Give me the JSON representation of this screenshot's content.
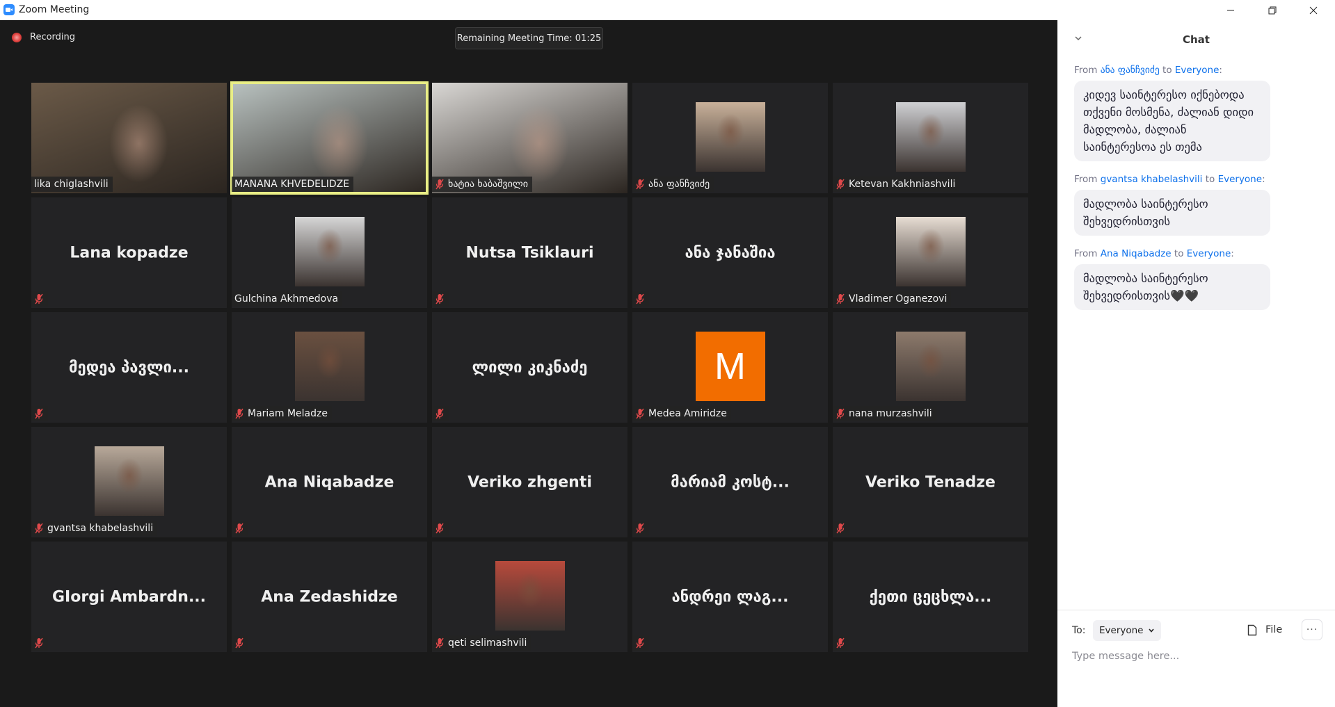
{
  "window": {
    "title": "Zoom Meeting",
    "controls": {
      "minimize": "minimize",
      "maximize": "restore",
      "close": "close"
    }
  },
  "meeting": {
    "recording_label": "Recording",
    "timer_text": "Remaining Meeting Time: 01:25"
  },
  "participants": [
    {
      "name": "lika chiglashvili",
      "mode": "video",
      "muted": false,
      "active": false,
      "scene": "#6b5a48"
    },
    {
      "name": "MANANA KHVEDELIDZE",
      "mode": "video",
      "muted": false,
      "active": true,
      "scene": "#b9c2c0"
    },
    {
      "name": "ხატია ხაბაშვილი",
      "mode": "video",
      "muted": true,
      "active": false,
      "scene": "#d9d7d4"
    },
    {
      "name": "ანა ფანჩვიძე",
      "mode": "photo",
      "muted": true,
      "active": false,
      "scene": "#c9b19a"
    },
    {
      "name": "Ketevan Kakhniashvili",
      "mode": "photo",
      "muted": true,
      "active": false,
      "scene": "#cfd0d3"
    },
    {
      "name": "Lana kopadze",
      "mode": "name",
      "muted": true,
      "active": false
    },
    {
      "name": "Gulchina Akhmedova",
      "mode": "photo",
      "muted": false,
      "active": false,
      "scene": "#d6d6d6"
    },
    {
      "name": "Nutsa Tsiklauri",
      "mode": "name",
      "muted": true,
      "active": false
    },
    {
      "name": "ანა ჯანაშია",
      "mode": "name",
      "muted": true,
      "active": false
    },
    {
      "name": "Vladimer Oganezovi",
      "mode": "photo",
      "muted": true,
      "active": false,
      "scene": "#e7ddd3"
    },
    {
      "name": "მედეა პავლი...",
      "mode": "name",
      "muted": true,
      "active": false
    },
    {
      "name": "Mariam Meladze",
      "mode": "photo",
      "muted": true,
      "active": false,
      "scene": "#6a5040"
    },
    {
      "name": "ლილი კიკნაძე",
      "mode": "name",
      "muted": true,
      "active": false
    },
    {
      "name": "Medea Amiridze",
      "mode": "letter",
      "letter": "M",
      "avatar_color": "#f26d00",
      "muted": true,
      "active": false
    },
    {
      "name": "nana murzashvili",
      "mode": "photo",
      "muted": true,
      "active": false,
      "scene": "#8d7a6c"
    },
    {
      "name": "gvantsa khabelashvili",
      "mode": "photo",
      "muted": true,
      "active": false,
      "scene": "#b8a99a"
    },
    {
      "name": "Ana Niqabadze",
      "mode": "name",
      "muted": true,
      "active": false
    },
    {
      "name": "Veriko zhgenti",
      "mode": "name",
      "muted": true,
      "active": false
    },
    {
      "name": "მარიამ კოსტ...",
      "mode": "name",
      "muted": true,
      "active": false
    },
    {
      "name": "Veriko Tenadze",
      "mode": "name",
      "muted": true,
      "active": false
    },
    {
      "name": "GIorgi Ambardn...",
      "mode": "name",
      "muted": true,
      "active": false
    },
    {
      "name": "Ana Zedashidze",
      "mode": "name",
      "muted": true,
      "active": false
    },
    {
      "name": "qeti selimashvili",
      "mode": "photo",
      "muted": true,
      "active": false,
      "scene": "#b84a3c"
    },
    {
      "name": "ანდრეი ლაგ...",
      "mode": "name",
      "muted": true,
      "active": false
    },
    {
      "name": "ქეთი ცეცხლა...",
      "mode": "name",
      "muted": true,
      "active": false
    }
  ],
  "chat": {
    "title": "Chat",
    "from_word": "From",
    "to_word": "to",
    "messages": [
      {
        "sender": "ანა ფანჩვიძე",
        "recipient": "Everyone",
        "text": "კიდევ საინტერესო იქნებოდა თქვენი მოსმენა, ძალიან დიდი მადლობა, ძალიან საინტერესოა ეს თემა"
      },
      {
        "sender": "gvantsa khabelashvili",
        "recipient": "Everyone",
        "text": "მადლობა საინტერესო შეხვედრისთვის"
      },
      {
        "sender": "Ana Niqabadze",
        "recipient": "Everyone",
        "text": "მადლობა საინტერესო შეხვედრისთვის🖤🖤"
      }
    ],
    "to_label": "To:",
    "to_value": "Everyone",
    "file_label": "File",
    "more_label": "···",
    "input_placeholder": "Type message here...",
    "input_value": ""
  },
  "colors": {
    "active_speaker": "#e9ee86",
    "mute_icon": "#e0494b",
    "link_blue": "#0e71eb",
    "recording_red": "#e0423f"
  }
}
